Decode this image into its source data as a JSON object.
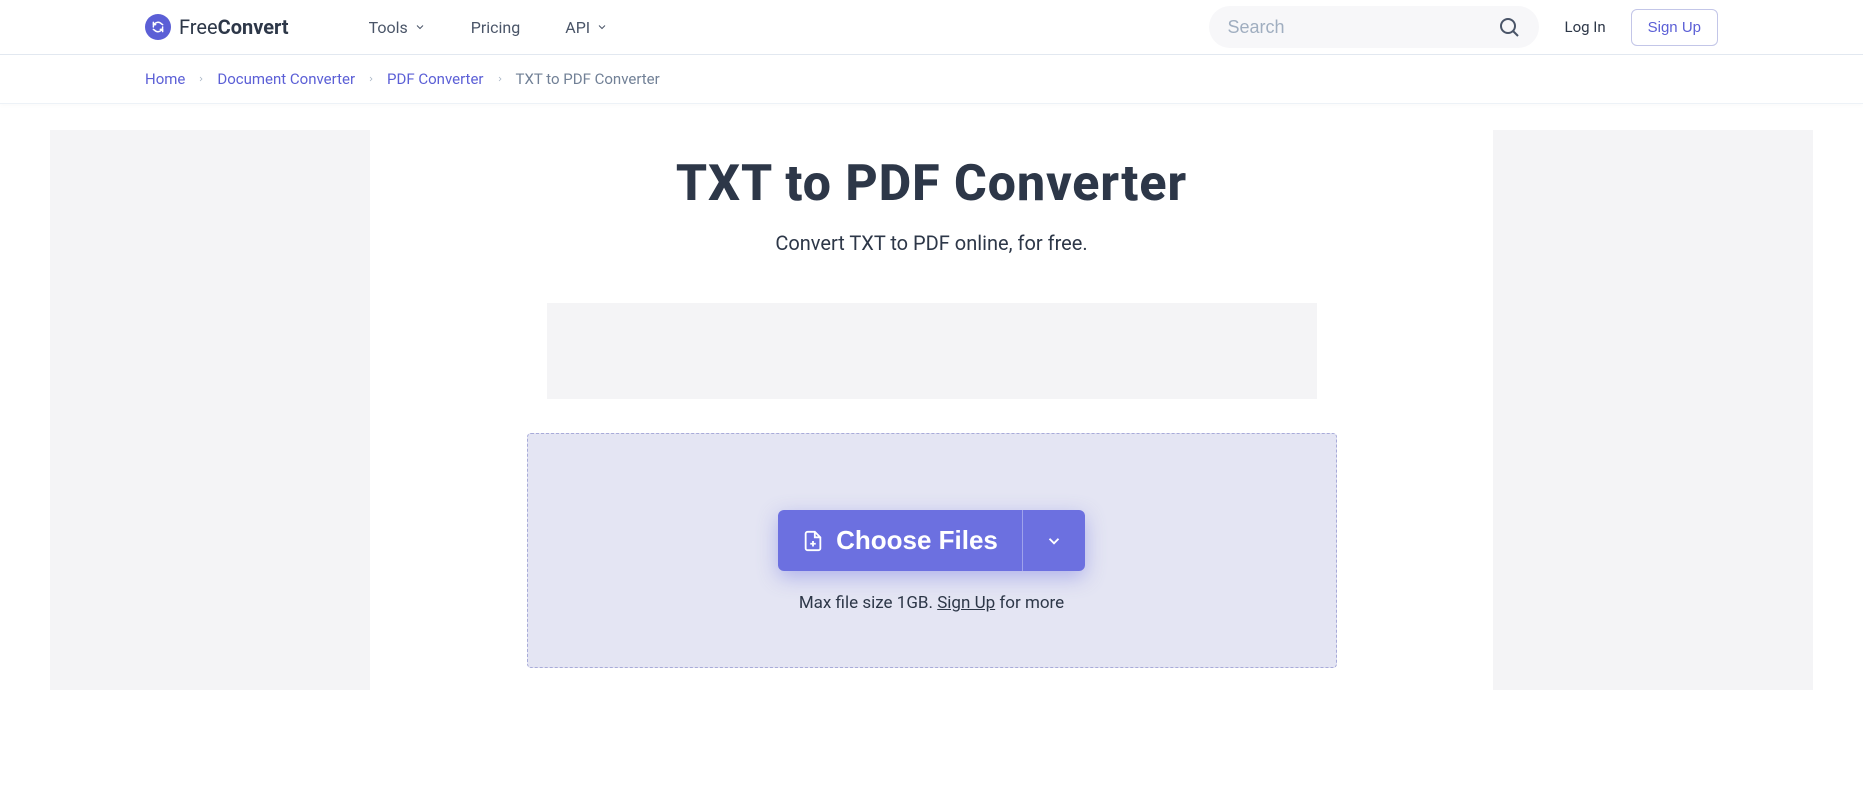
{
  "header": {
    "logo": {
      "prefix": "Free",
      "suffix": "Convert"
    },
    "nav": {
      "tools": "Tools",
      "pricing": "Pricing",
      "api": "API"
    },
    "search_placeholder": "Search",
    "login": "Log In",
    "signup": "Sign Up"
  },
  "breadcrumb": {
    "home": "Home",
    "doc_converter": "Document Converter",
    "pdf_converter": "PDF Converter",
    "current": "TXT to PDF Converter"
  },
  "main": {
    "title": "TXT to PDF Converter",
    "subtitle": "Convert TXT to PDF online, for free.",
    "choose_files": "Choose Files",
    "size_prefix": "Max file size 1GB. ",
    "signup_link": "Sign Up",
    "size_suffix": " for more"
  }
}
